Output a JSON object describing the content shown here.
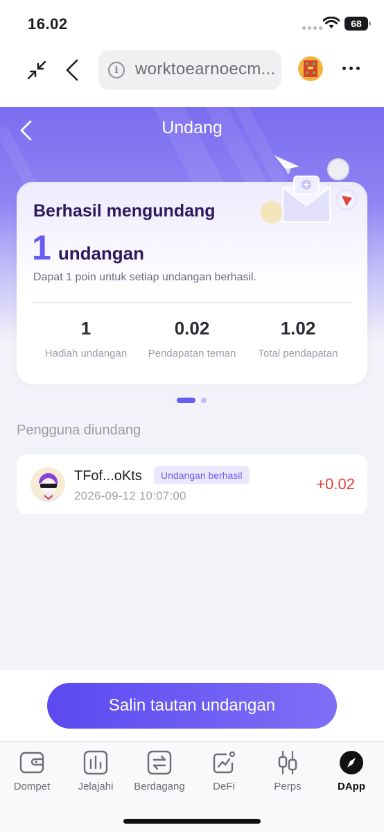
{
  "status_bar": {
    "time": "16.02",
    "battery": "68"
  },
  "browser": {
    "url": "worktoearnoecm...",
    "info_icon": "i"
  },
  "page": {
    "title": "Undang"
  },
  "summary": {
    "headline": "Berhasil mengundang",
    "count": "1",
    "count_unit": "undangan",
    "description": "Dapat 1 poin untuk setiap undangan berhasil.",
    "stats": [
      {
        "value": "1",
        "label": "Hadiah undangan"
      },
      {
        "value": "0.02",
        "label": "Pendapatan teman"
      },
      {
        "value": "1.02",
        "label": "Total pendapatan"
      }
    ]
  },
  "invited": {
    "title": "Pengguna diundang",
    "users": [
      {
        "name": "TFof...oKts",
        "badge": "Undangan berhasil",
        "date": "2026-09-12 10:07:00",
        "amount": "+0.02"
      }
    ]
  },
  "cta": {
    "label": "Salin tautan undangan"
  },
  "tabs": [
    {
      "label": "Dompet",
      "icon": "wallet-icon"
    },
    {
      "label": "Jelajahi",
      "icon": "chart-icon"
    },
    {
      "label": "Berdagang",
      "icon": "swap-icon"
    },
    {
      "label": "DeFi",
      "icon": "defi-icon"
    },
    {
      "label": "Perps",
      "icon": "candles-icon"
    },
    {
      "label": "DApp",
      "icon": "compass-icon",
      "active": true
    }
  ],
  "colors": {
    "accent": "#6a5cf3",
    "positive_amount": "#e0403b"
  }
}
